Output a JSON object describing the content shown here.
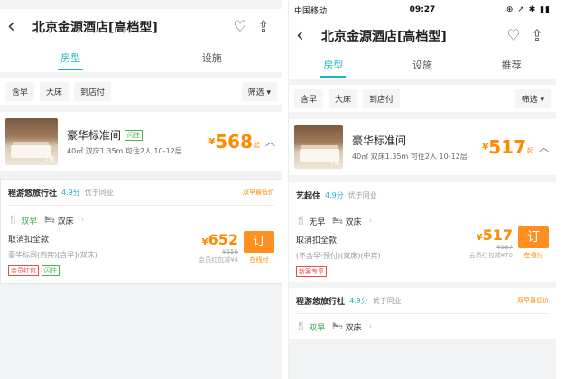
{
  "left": {
    "header": {
      "title": "北京金源酒店[高档型]"
    },
    "tabs": [
      {
        "label": "房型"
      },
      {
        "label": "设施"
      }
    ],
    "filters": {
      "chips": [
        "含早",
        "大床",
        "到店付"
      ],
      "sort": "筛选 ▾"
    },
    "room": {
      "name": "豪华标准间",
      "flash_tag": "闪住",
      "desc": "40㎡ 双床1.35m 可住2人 10-12层",
      "thumb_count": "1张",
      "currency": "¥",
      "price": "568",
      "price_suffix": "起"
    },
    "offer": {
      "vendor": "程游悠旅行社",
      "score": "4.9分",
      "note": "优于同业",
      "vendor_link": "双早最低价",
      "meal": "双早",
      "bed": "双床",
      "cancel": "取消扣全款",
      "fine": "豪华标间(内宾)[含早](双床)",
      "badges": [
        "会员红包",
        "闪住"
      ],
      "currency": "¥",
      "price": "652",
      "strike": "¥656",
      "return_note": "会员红包减¥4",
      "book_label": "订",
      "book_sub": "在线付"
    }
  },
  "right": {
    "status": {
      "carrier": "中国移动",
      "time": "09:27",
      "icons": "⊕ ↗ ✱ ▮▮"
    },
    "header": {
      "title": "北京金源酒店[高档型]"
    },
    "tabs": [
      {
        "label": "房型"
      },
      {
        "label": "设施"
      },
      {
        "label": "推荐"
      }
    ],
    "filters": {
      "chips": [
        "含早",
        "大床",
        "到店付"
      ],
      "sort": "筛选 ▾"
    },
    "room": {
      "name": "豪华标准间",
      "desc": "40㎡ 双床1.35m 可住2人 10-12层",
      "thumb_count": "1张",
      "currency": "¥",
      "price": "517",
      "price_suffix": "起"
    },
    "offer": {
      "vendor": "艺起住",
      "score": "4.9分",
      "note": "优于同业",
      "meal": "无早",
      "bed": "双床",
      "cancel": "取消扣全款",
      "fine": "(不含早-预付)(双床)(中宾)",
      "badges": [
        "新客专享"
      ],
      "currency": "¥",
      "price": "517",
      "strike": "¥587",
      "return_note": "会员红包减¥70",
      "book_label": "订",
      "book_sub": "在线付"
    },
    "offer2": {
      "vendor": "程游悠旅行社",
      "score": "4.9分",
      "note": "优于同业",
      "vendor_link": "双早最低价",
      "meal": "双早",
      "bed": "双床"
    }
  }
}
